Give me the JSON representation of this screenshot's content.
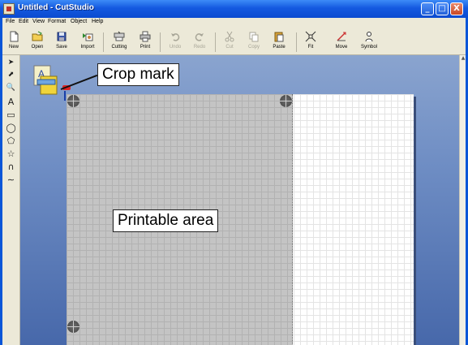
{
  "window": {
    "title": "Untitled - CutStudio",
    "minimize_glyph": "_",
    "maximize_glyph": "□",
    "close_glyph": "X"
  },
  "menubar": [
    "File",
    "Edit",
    "View",
    "Format",
    "Object",
    "Help"
  ],
  "toolbar": [
    {
      "label": "New",
      "icon": "new-document-icon",
      "enabled": true
    },
    {
      "label": "Open",
      "icon": "open-folder-icon",
      "enabled": true
    },
    {
      "label": "Save",
      "icon": "save-disk-icon",
      "enabled": true
    },
    {
      "label": "Import",
      "icon": "import-icon",
      "enabled": true
    },
    {
      "label": "Cutting",
      "icon": "cutting-icon",
      "enabled": true
    },
    {
      "label": "Print",
      "icon": "printer-icon",
      "enabled": true
    },
    {
      "label": "Undo",
      "icon": "undo-icon",
      "enabled": false
    },
    {
      "label": "Redo",
      "icon": "redo-icon",
      "enabled": false
    },
    {
      "label": "Cut",
      "icon": "scissors-icon",
      "enabled": false
    },
    {
      "label": "Copy",
      "icon": "copy-icon",
      "enabled": false
    },
    {
      "label": "Paste",
      "icon": "paste-icon",
      "enabled": true
    },
    {
      "label": "Fit",
      "icon": "fit-icon",
      "enabled": true
    },
    {
      "label": "Move",
      "icon": "move-icon",
      "enabled": true
    },
    {
      "label": "Symbol",
      "icon": "symbol-icon",
      "enabled": true
    }
  ],
  "tools": [
    {
      "name": "select-arrow-icon",
      "glyph": "➤"
    },
    {
      "name": "node-select-icon",
      "glyph": "⬈"
    },
    {
      "name": "zoom-icon",
      "glyph": "🔍"
    },
    {
      "name": "text-tool-icon",
      "glyph": "A"
    },
    {
      "name": "rectangle-tool-icon",
      "glyph": "▭"
    },
    {
      "name": "ellipse-tool-icon",
      "glyph": "◯"
    },
    {
      "name": "polygon-tool-icon",
      "glyph": "⬠"
    },
    {
      "name": "star-tool-icon",
      "glyph": "☆"
    },
    {
      "name": "curve-tool-icon",
      "glyph": "∩"
    },
    {
      "name": "freehand-tool-icon",
      "glyph": "∼"
    }
  ],
  "callouts": {
    "crop_mark": "Crop mark",
    "printable_area": "Printable area"
  },
  "colors": {
    "titlebar": "#1459e0",
    "chrome": "#ece9d8",
    "printable": "#c4c4c4",
    "canvas": "#6d8cc3"
  }
}
